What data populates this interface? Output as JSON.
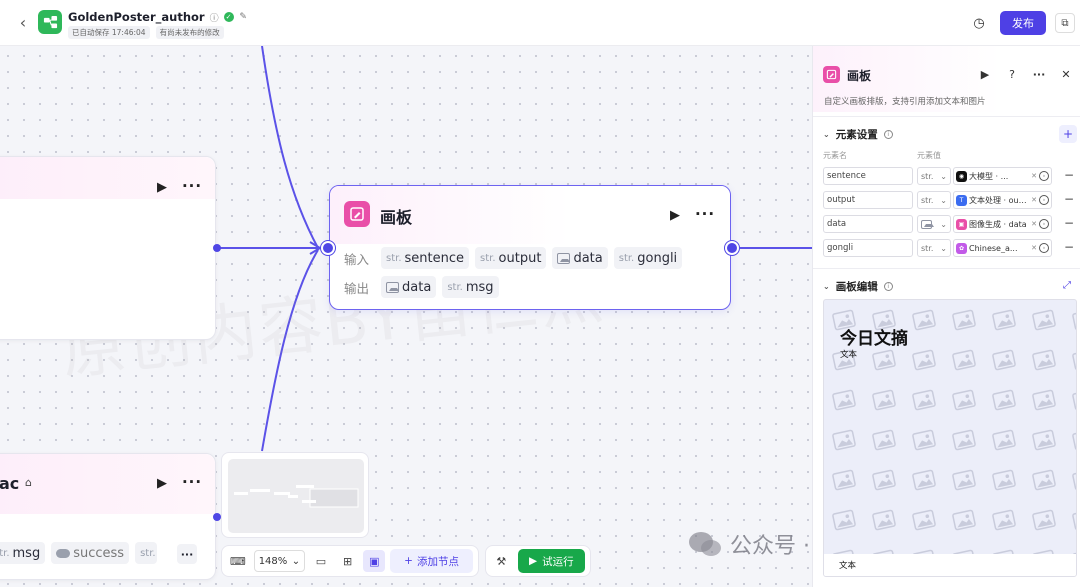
{
  "header": {
    "title": "GoldenPoster_author",
    "autosave": "已自动保存 17:46:04",
    "unpublished": "有尚未发布的修改",
    "publish_label": "发布"
  },
  "canvas": {
    "main_node": {
      "title": "画板",
      "input_label": "输入",
      "output_label": "输出",
      "inputs": [
        {
          "type": "str.",
          "name": "sentence"
        },
        {
          "type": "str.",
          "name": "output"
        },
        {
          "type": "image",
          "name": "data"
        },
        {
          "type": "str.",
          "name": "gongli"
        }
      ],
      "outputs": [
        {
          "type": "image",
          "name": "data"
        },
        {
          "type": "str.",
          "name": "msg"
        }
      ]
    },
    "left_node_bottom": {
      "title_fragment": "ac",
      "outputs": [
        {
          "type": "str.",
          "name": "msg"
        },
        {
          "type": "bool",
          "name": "success"
        },
        {
          "type": "str.",
          "name": "str"
        }
      ]
    },
    "watermark": "原创内容BY笛仁杰",
    "wechat_text": "公众号 · 笛仁杰聊AIGC"
  },
  "toolbar": {
    "zoom": "148%",
    "add_node_label": "添加节点",
    "run_label": "试运行"
  },
  "panel": {
    "title": "画板",
    "description": "自定义画板排版，支持引用添加文本和图片",
    "elements_section": "元素设置",
    "col_name": "元素名",
    "col_value": "元素值",
    "elements": [
      {
        "name": "sentence",
        "type": "str.",
        "source_icon": "llm-icon",
        "value": "大模型 · ...",
        "color": "#111111"
      },
      {
        "name": "output",
        "type": "str.",
        "source_icon": "text-process-icon",
        "value": "文本处理 · output",
        "color": "#3b6cf0"
      },
      {
        "name": "data",
        "type": "image",
        "source_icon": "image-gen-icon",
        "value": "图像生成 · data",
        "color": "#e94fa8"
      },
      {
        "name": "gongli",
        "type": "str.",
        "source_icon": "plugin-icon",
        "value": "Chinese_a...",
        "color": "#c25ae8"
      }
    ],
    "board_section": "画板编辑",
    "board": {
      "title": "今日文摘",
      "subtitle": "文本",
      "footer": "文本"
    }
  },
  "colors": {
    "accent": "#4e40e5",
    "node_icon": "#e94fa8",
    "run": "#18a84a",
    "app_logo": "#2fb85a"
  }
}
